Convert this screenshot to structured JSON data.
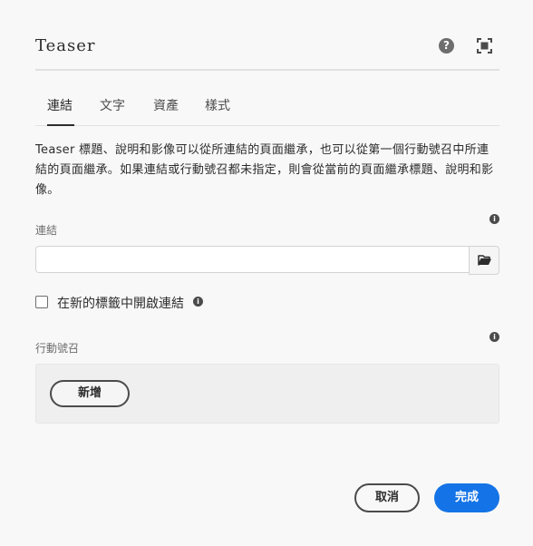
{
  "dialog": {
    "title": "Teaser",
    "help_icon": "question-circle-icon",
    "fullscreen_icon": "fullscreen-icon"
  },
  "tabs": [
    {
      "label": "連結",
      "active": true
    },
    {
      "label": "文字",
      "active": false
    },
    {
      "label": "資產",
      "active": false
    },
    {
      "label": "樣式",
      "active": false
    }
  ],
  "description": "Teaser 標題、說明和影像可以從所連結的頁面繼承，也可以從第一個行動號召中所連結的頁面繼承。如果連結或行動號召都未指定，則會從當前的頁面繼承標題、說明和影像。",
  "link_field": {
    "label": "連結",
    "value": "",
    "placeholder": "",
    "browse_icon": "folder-open-icon"
  },
  "new_tab_checkbox": {
    "label": "在新的標籤中開啟連結",
    "checked": false
  },
  "cta": {
    "label": "行動號召",
    "add_label": "新增"
  },
  "footer": {
    "cancel_label": "取消",
    "done_label": "完成"
  },
  "colors": {
    "accent": "#1473e6",
    "text": "#2c2c2c",
    "muted": "#6e6e6e",
    "background": "#f8f8f8"
  }
}
